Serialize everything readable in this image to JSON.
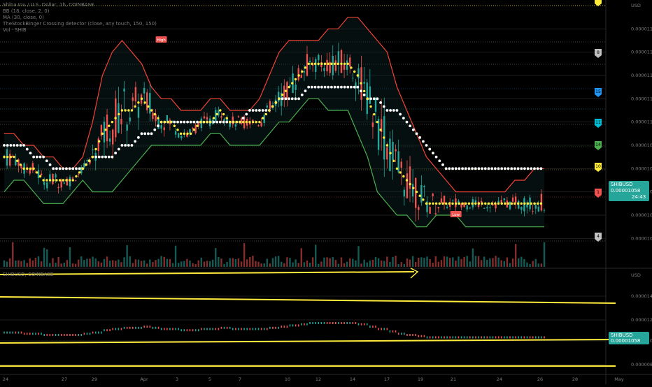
{
  "legend": {
    "title": "Shiba Inu / U.S. Dollar, 1h, COINBASE",
    "bb": "BB (18, close, 2, 0)",
    "ma": "MA (30, close, 0)",
    "detector": "TheStockBinger Crossing detector (close, any touch, 150, 150)",
    "vol": "Vol · SHIB"
  },
  "main_price_axis": [
    "0.00001180",
    "0.00001160",
    "0.00001140",
    "0.00001120",
    "0.00001100",
    "0.00001080",
    "0.00001060",
    "0.00001040",
    "0.00001020",
    "0.00001000"
  ],
  "main_top_label": "USD",
  "sub_price_axis": [
    "0.00001400",
    "0.00001200",
    "0.00001000",
    "0.00000800"
  ],
  "sub_top_label": "USD",
  "sub_title": "SHIBUSD, COINBASE",
  "current_price": {
    "symbol": "SHIBUSD",
    "value": "0.00001058",
    "countdown": "24:43",
    "color": "#26a69a"
  },
  "sub_current_price": {
    "symbol": "SHIBUSD",
    "value": "0.00001058",
    "color": "#26a69a"
  },
  "markers": [
    {
      "label": "High",
      "color": "#ef5350",
      "x": 32,
      "y": 1.17e-05
    },
    {
      "label": "Low",
      "color": "#ef5350",
      "x": 92,
      "y": 1.02e-05
    }
  ],
  "alert_tags": [
    {
      "label": "8",
      "color": "#c0c0c0"
    },
    {
      "label": "15",
      "color": "#2196f3"
    },
    {
      "label": "11",
      "color": "#00bcd4"
    },
    {
      "label": "14",
      "color": "#4caf50"
    },
    {
      "label": "10",
      "color": "#ffeb3b"
    },
    {
      "label": "1",
      "color": "#ef5350"
    },
    {
      "label": "4",
      "color": "#c0c0c0"
    }
  ],
  "top_tag": {
    "label": "",
    "color": "#ffeb3b"
  },
  "dates": [
    "24",
    "27",
    "29",
    "Apr",
    "3",
    "5",
    "7",
    "10",
    "12",
    "14",
    "17",
    "19",
    "21",
    "24",
    "26",
    "28",
    "May"
  ],
  "colors": {
    "up": "#26a69a",
    "down": "#ef5350",
    "bb_band": "#f44336",
    "bb_lower": "#4caf50",
    "ma": "#ffffff",
    "midline": "#ffeb3b",
    "trendline": "#ffeb3b"
  },
  "chart_data": {
    "type": "line",
    "title": "Shiba Inu / U.S. Dollar, 1h, COINBASE",
    "ylim": [
      9.9e-06,
      1.2e-05
    ],
    "x": [
      0,
      2,
      4,
      6,
      8,
      10,
      12,
      14,
      16,
      18,
      20,
      22,
      24,
      26,
      28,
      30,
      32,
      34,
      36,
      38,
      40,
      42,
      44,
      46,
      48,
      50,
      52,
      54,
      56,
      58,
      60,
      62,
      64,
      66,
      68,
      70,
      72,
      74,
      76,
      78,
      80,
      82,
      84,
      86,
      88,
      90,
      92,
      94,
      96,
      98,
      100,
      102,
      104,
      106,
      108,
      110
    ],
    "series": [
      {
        "name": "BB upper",
        "values": [
          1.09e-05,
          1.09e-05,
          1.08e-05,
          1.08e-05,
          1.07e-05,
          1.07e-05,
          1.06e-05,
          1.06e-05,
          1.07e-05,
          1.1e-05,
          1.14e-05,
          1.16e-05,
          1.17e-05,
          1.16e-05,
          1.15e-05,
          1.13e-05,
          1.12e-05,
          1.12e-05,
          1.11e-05,
          1.11e-05,
          1.11e-05,
          1.12e-05,
          1.12e-05,
          1.11e-05,
          1.11e-05,
          1.11e-05,
          1.12e-05,
          1.14e-05,
          1.16e-05,
          1.17e-05,
          1.17e-05,
          1.17e-05,
          1.17e-05,
          1.18e-05,
          1.18e-05,
          1.19e-05,
          1.19e-05,
          1.18e-05,
          1.17e-05,
          1.16e-05,
          1.13e-05,
          1.11e-05,
          1.09e-05,
          1.07e-05,
          1.06e-05,
          1.05e-05,
          1.04e-05,
          1.04e-05,
          1.04e-05,
          1.04e-05,
          1.04e-05,
          1.04e-05,
          1.05e-05,
          1.05e-05,
          1.06e-05,
          1.06e-05
        ]
      },
      {
        "name": "BB lower",
        "values": [
          1.04e-05,
          1.05e-05,
          1.05e-05,
          1.04e-05,
          1.03e-05,
          1.03e-05,
          1.03e-05,
          1.04e-05,
          1.05e-05,
          1.04e-05,
          1.04e-05,
          1.04e-05,
          1.05e-05,
          1.06e-05,
          1.07e-05,
          1.08e-05,
          1.08e-05,
          1.08e-05,
          1.08e-05,
          1.08e-05,
          1.08e-05,
          1.09e-05,
          1.09e-05,
          1.08e-05,
          1.08e-05,
          1.08e-05,
          1.08e-05,
          1.09e-05,
          1.1e-05,
          1.1e-05,
          1.11e-05,
          1.12e-05,
          1.12e-05,
          1.11e-05,
          1.11e-05,
          1.11e-05,
          1.09e-05,
          1.07e-05,
          1.04e-05,
          1.03e-05,
          1.02e-05,
          1.02e-05,
          1.01e-05,
          1.01e-05,
          1.02e-05,
          1.02e-05,
          1.02e-05,
          1.01e-05,
          1.01e-05,
          1.01e-05,
          1.01e-05,
          1.01e-05,
          1.01e-05,
          1.01e-05,
          1.01e-05,
          1.01e-05
        ]
      },
      {
        "name": "MA",
        "values": [
          1.08e-05,
          1.08e-05,
          1.08e-05,
          1.07e-05,
          1.07e-05,
          1.06e-05,
          1.06e-05,
          1.06e-05,
          1.06e-05,
          1.07e-05,
          1.07e-05,
          1.07e-05,
          1.08e-05,
          1.08e-05,
          1.09e-05,
          1.09e-05,
          1.1e-05,
          1.1e-05,
          1.1e-05,
          1.1e-05,
          1.1e-05,
          1.1e-05,
          1.1e-05,
          1.1e-05,
          1.1e-05,
          1.11e-05,
          1.11e-05,
          1.11e-05,
          1.12e-05,
          1.12e-05,
          1.12e-05,
          1.13e-05,
          1.13e-05,
          1.13e-05,
          1.13e-05,
          1.13e-05,
          1.13e-05,
          1.12e-05,
          1.12e-05,
          1.11e-05,
          1.11e-05,
          1.1e-05,
          1.09e-05,
          1.08e-05,
          1.07e-05,
          1.06e-05,
          1.06e-05,
          1.06e-05,
          1.06e-05,
          1.06e-05,
          1.06e-05,
          1.06e-05,
          1.06e-05,
          1.06e-05,
          1.06e-05,
          1.06e-05
        ]
      },
      {
        "name": "BB basis",
        "values": [
          1.07e-05,
          1.07e-05,
          1.06e-05,
          1.06e-05,
          1.05e-05,
          1.05e-05,
          1.05e-05,
          1.05e-05,
          1.06e-05,
          1.07e-05,
          1.09e-05,
          1.1e-05,
          1.11e-05,
          1.11e-05,
          1.12e-05,
          1.11e-05,
          1.1e-05,
          1.1e-05,
          1.09e-05,
          1.09e-05,
          1.1e-05,
          1.1e-05,
          1.11e-05,
          1.1e-05,
          1.1e-05,
          1.1e-05,
          1.1e-05,
          1.11e-05,
          1.12e-05,
          1.13e-05,
          1.14e-05,
          1.15e-05,
          1.15e-05,
          1.15e-05,
          1.15e-05,
          1.15e-05,
          1.14e-05,
          1.12e-05,
          1.1e-05,
          1.08e-05,
          1.06e-05,
          1.05e-05,
          1.04e-05,
          1.03e-05,
          1.03e-05,
          1.03e-05,
          1.03e-05,
          1.03e-05,
          1.03e-05,
          1.03e-05,
          1.03e-05,
          1.03e-05,
          1.03e-05,
          1.03e-05,
          1.03e-05,
          1.03e-05
        ]
      }
    ],
    "grid": true,
    "legend": "top-left"
  }
}
